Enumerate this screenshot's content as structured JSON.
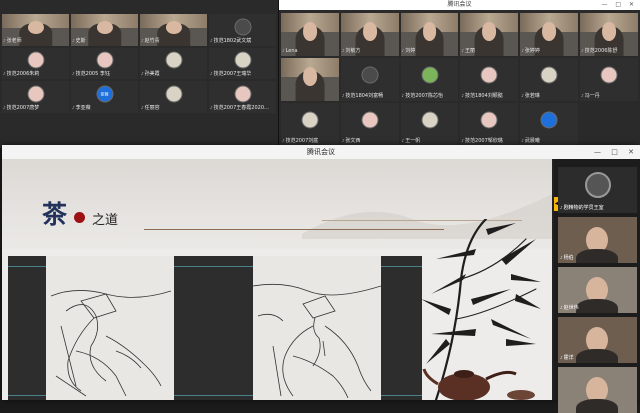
{
  "left_window": {
    "tiles": [
      {
        "name": "张老师",
        "video": true
      },
      {
        "name": "史斯",
        "video": true
      },
      {
        "name": "赵竹青",
        "video": true
      },
      {
        "name": "技范1802武文斌",
        "avatar": "dark"
      },
      {
        "name": "技范2006朱莉",
        "avatar": "pink"
      },
      {
        "name": "技范2005 李钰",
        "avatar": "pink"
      },
      {
        "name": "孙美霞",
        "avatar": "light"
      },
      {
        "name": "技范2007王瑞华",
        "avatar": "light"
      },
      {
        "name": "技范2007唐梦",
        "avatar": "pink"
      },
      {
        "name": "李亚薇",
        "avatar": "blue",
        "avatar_text": "亚薇"
      },
      {
        "name": "任丽容",
        "avatar": "light"
      },
      {
        "name": "技范2007王春霞2020...",
        "avatar": "pink"
      }
    ]
  },
  "right_window": {
    "title": "腾讯会议",
    "speaker_name": "Lena",
    "tiles": [
      {
        "name": "Lena",
        "video": true
      },
      {
        "name": "刘敏方",
        "video": true
      },
      {
        "name": "刘婷",
        "video": true
      },
      {
        "name": "王丽",
        "video": true
      },
      {
        "name": "张婷婷",
        "video": true
      },
      {
        "name": "技范2006陈舒",
        "video": true
      },
      {
        "name": "",
        "video": true
      },
      {
        "name": "技范1804刘富畅",
        "avatar": "dark"
      },
      {
        "name": "技范2007陈芯怡",
        "avatar": "green"
      },
      {
        "name": "技范1804刘颖懿",
        "avatar": "pink"
      },
      {
        "name": "张若琳",
        "avatar": "light"
      },
      {
        "name": "冯一丹",
        "avatar": "pink"
      },
      {
        "name": "技范2007刘庭",
        "avatar": "light"
      },
      {
        "name": "张文西",
        "avatar": "pink"
      },
      {
        "name": "王一帆",
        "avatar": "light"
      },
      {
        "name": "技范2007邹欣璐",
        "avatar": "pink"
      },
      {
        "name": "武晨曦",
        "avatar": "blue",
        "avatar_text": ""
      }
    ]
  },
  "front_window": {
    "title": "腾讯会议",
    "controls": [
      "—",
      "□",
      "✕"
    ],
    "slide": {
      "title_big": "茶",
      "title_small": "之道"
    },
    "participants": [
      {
        "name": "剧精物的学员王室",
        "kind": "avatar"
      },
      {
        "name": "杨伯",
        "kind": "video"
      },
      {
        "name": "赵世伟",
        "kind": "video"
      },
      {
        "name": "霍洋",
        "kind": "video"
      },
      {
        "name": "",
        "kind": "video"
      }
    ]
  }
}
